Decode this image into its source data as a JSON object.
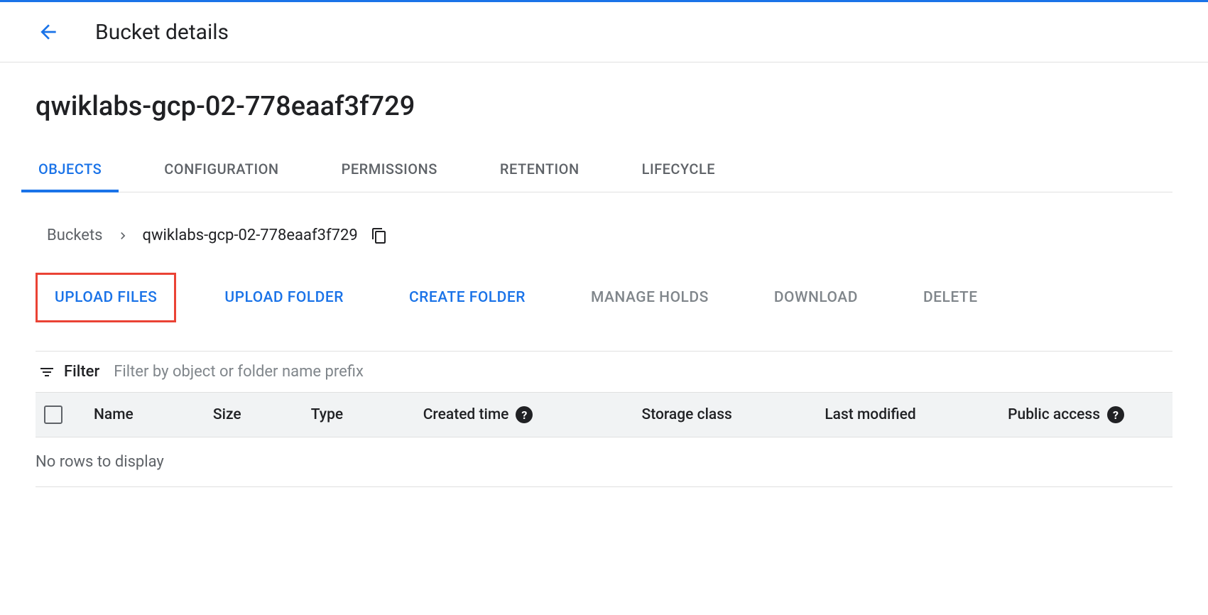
{
  "header": {
    "title": "Bucket details"
  },
  "bucket": {
    "name": "qwiklabs-gcp-02-778eaaf3f729"
  },
  "tabs": [
    {
      "label": "OBJECTS",
      "active": true
    },
    {
      "label": "CONFIGURATION",
      "active": false
    },
    {
      "label": "PERMISSIONS",
      "active": false
    },
    {
      "label": "RETENTION",
      "active": false
    },
    {
      "label": "LIFECYCLE",
      "active": false
    }
  ],
  "breadcrumb": {
    "root": "Buckets",
    "current": "qwiklabs-gcp-02-778eaaf3f729"
  },
  "actions": {
    "upload_files": "UPLOAD FILES",
    "upload_folder": "UPLOAD FOLDER",
    "create_folder": "CREATE FOLDER",
    "manage_holds": "MANAGE HOLDS",
    "download": "DOWNLOAD",
    "delete": "DELETE"
  },
  "filter": {
    "label": "Filter",
    "placeholder": "Filter by object or folder name prefix"
  },
  "table": {
    "columns": {
      "name": "Name",
      "size": "Size",
      "type": "Type",
      "created": "Created time",
      "storage": "Storage class",
      "modified": "Last modified",
      "public": "Public access"
    },
    "empty": "No rows to display"
  }
}
